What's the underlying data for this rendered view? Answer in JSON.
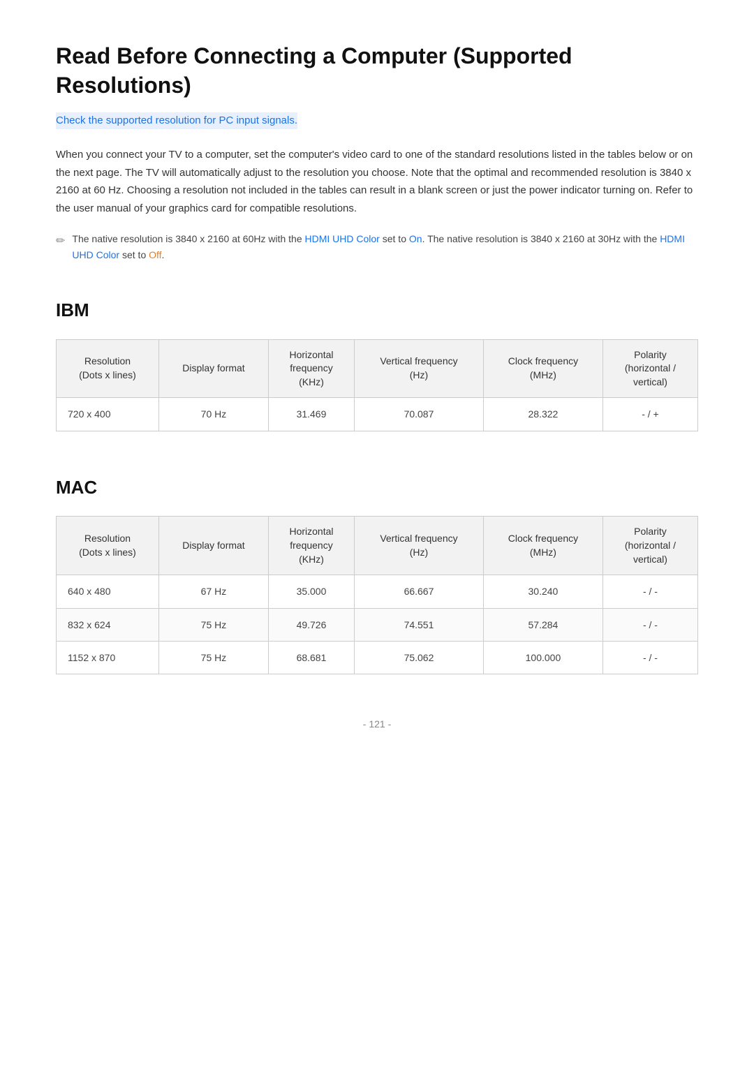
{
  "page": {
    "title": "Read Before Connecting a Computer (Supported Resolutions)",
    "highlight_link": "Check the supported resolution for PC input signals.",
    "intro_text": "When you connect your TV to a computer, set the computer's video card to one of the standard resolutions listed in the tables below or on the next page. The TV will automatically adjust to the resolution you choose. Note that the optimal and recommended resolution is 3840 x 2160 at 60 Hz. Choosing a resolution not included in the tables can result in a blank screen or just the power indicator turning on. Refer to the user manual of your graphics card for compatible resolutions.",
    "note": {
      "text_before_link1": "The native resolution is 3840 x 2160 at 60Hz with the ",
      "link1_text": "HDMI UHD Color",
      "text_between": " set to ",
      "link1_value": "On",
      "text_after_link1": ". The native resolution is 3840 x 2160 at 30Hz with the ",
      "link2_text": "HDMI UHD Color",
      "text_before_off": " set to ",
      "link2_value": "Off",
      "text_end": "."
    }
  },
  "ibm_section": {
    "title": "IBM",
    "table": {
      "headers": [
        {
          "label": "Resolution\n(Dots x lines)",
          "sub": ""
        },
        {
          "label": "Display format",
          "sub": ""
        },
        {
          "label": "Horizontal frequency",
          "sub": "(KHz)"
        },
        {
          "label": "Vertical frequency",
          "sub": "(Hz)"
        },
        {
          "label": "Clock frequency",
          "sub": "(MHz)"
        },
        {
          "label": "Polarity\n(horizontal /\nvertical)",
          "sub": ""
        }
      ],
      "rows": [
        {
          "resolution": "720 x 400",
          "display_format": "70 Hz",
          "h_freq": "31.469",
          "v_freq": "70.087",
          "clock_freq": "28.322",
          "polarity": "- / +"
        }
      ]
    }
  },
  "mac_section": {
    "title": "MAC",
    "table": {
      "headers": [
        {
          "label": "Resolution\n(Dots x lines)",
          "sub": ""
        },
        {
          "label": "Display format",
          "sub": ""
        },
        {
          "label": "Horizontal frequency",
          "sub": "(KHz)"
        },
        {
          "label": "Vertical frequency",
          "sub": "(Hz)"
        },
        {
          "label": "Clock frequency",
          "sub": "(MHz)"
        },
        {
          "label": "Polarity\n(horizontal /\nvertical)",
          "sub": ""
        }
      ],
      "rows": [
        {
          "resolution": "640 x 480",
          "display_format": "67 Hz",
          "h_freq": "35.000",
          "v_freq": "66.667",
          "clock_freq": "30.240",
          "polarity": "- / -"
        },
        {
          "resolution": "832 x 624",
          "display_format": "75 Hz",
          "h_freq": "49.726",
          "v_freq": "74.551",
          "clock_freq": "57.284",
          "polarity": "- / -"
        },
        {
          "resolution": "1152 x 870",
          "display_format": "75 Hz",
          "h_freq": "68.681",
          "v_freq": "75.062",
          "clock_freq": "100.000",
          "polarity": "- / -"
        }
      ]
    }
  },
  "footer": {
    "page_number": "- 121 -"
  }
}
